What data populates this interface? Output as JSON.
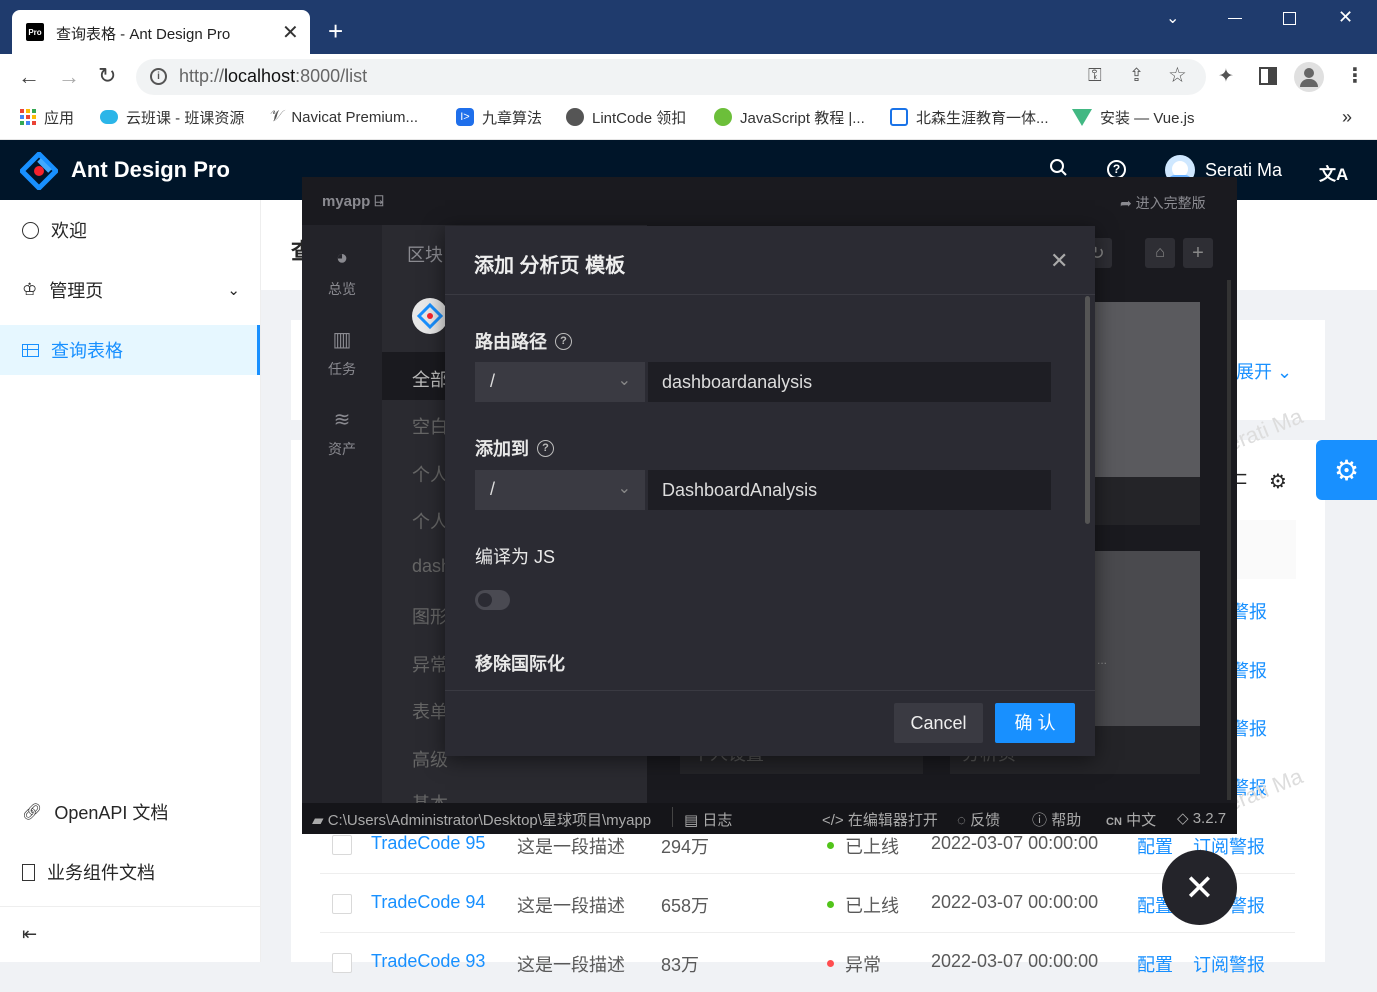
{
  "browser": {
    "tab_title": "查询表格 - Ant Design Pro",
    "url_prefix": "http://",
    "url_host": "localhost",
    "url_rest": ":8000/list",
    "favicon": "Pro"
  },
  "bookmarks": [
    {
      "label": "应用",
      "color": "#d93025"
    },
    {
      "label": "云班课 - 班课资源",
      "color": "#2bb5e8"
    },
    {
      "label": "Navicat Premium...",
      "color": "#555"
    },
    {
      "label": "九章算法",
      "color": "#1f6feb"
    },
    {
      "label": "LintCode 领扣",
      "color": "#555"
    },
    {
      "label": "JavaScript 教程 |...",
      "color": "#6cbf3a"
    },
    {
      "label": "北森生涯教育一体...",
      "color": "#1a73e8"
    },
    {
      "label": "安装 — Vue.js",
      "color": "#42b883"
    }
  ],
  "bookmarks_more": "»",
  "app": {
    "logo_text": "Ant Design Pro",
    "user_name": "Serati Ma",
    "lang_icon": "文A"
  },
  "sider": {
    "items": [
      {
        "label": "欢迎"
      },
      {
        "label": "管理页"
      },
      {
        "label": "查询表格"
      },
      {
        "label": "OpenAPI 文档"
      },
      {
        "label": "业务组件文档"
      }
    ]
  },
  "page": {
    "title_char": "查",
    "expand": "展开",
    "rows": [
      {
        "name": "TradeCode 95",
        "desc": "这是一段描述",
        "calls": "294万",
        "status": "已上线",
        "time": "2022-03-07 00:00:00",
        "a1": "配置",
        "a2": "订阅警报"
      },
      {
        "name": "TradeCode 94",
        "desc": "这是一段描述",
        "calls": "658万",
        "status": "已上线",
        "time": "2022-03-07 00:00:00",
        "a1": "配置",
        "a2": "订阅警报"
      },
      {
        "name": "TradeCode 93",
        "desc": "这是一段描述",
        "calls": "83万",
        "status": "异常",
        "time": "2022-03-07 00:00:00",
        "a1": "配置",
        "a2": "订阅警报"
      }
    ],
    "partial_links": [
      "警报",
      "警报",
      "警报",
      "警报"
    ],
    "watermark": "Serati Ma"
  },
  "umi": {
    "app_name": "myapp",
    "full_version": "进入完整版",
    "nav": [
      {
        "label": "总览"
      },
      {
        "label": "任务"
      },
      {
        "label": "资产"
      }
    ],
    "section_title": "区块",
    "list": [
      "全部",
      "空白",
      "个人",
      "个人",
      "dash",
      "图形",
      "异常",
      "表单",
      "高级",
      "基本"
    ],
    "peek_bottom": [
      "个人设置",
      "分析页"
    ],
    "footer": {
      "path": "C:\\Users\\Administrator\\Desktop\\星球项目\\myapp",
      "log": "日志",
      "editor": "在编辑器打开",
      "feedback": "反馈",
      "help": "帮助",
      "lang": "中文",
      "lang_code": "CN",
      "version": "3.2.7"
    }
  },
  "modal": {
    "title": "添加 分析页 模板",
    "route_label": "路由路径",
    "route_prefix": "/",
    "route_value": "dashboardanalysis",
    "addto_label": "添加到",
    "addto_prefix": "/",
    "addto_value": "DashboardAnalysis",
    "compile_label": "编译为 JS",
    "compile_on": false,
    "i18n_label": "移除国际化",
    "cancel": "Cancel",
    "ok": "确 认"
  },
  "colors": {
    "primary": "#1890ff",
    "header": "#001529",
    "chrome": "#1f3b6d",
    "dark": "#1a1a1f",
    "modal": "#2b2b33",
    "success": "#52c41a",
    "error": "#ff4d4f"
  }
}
